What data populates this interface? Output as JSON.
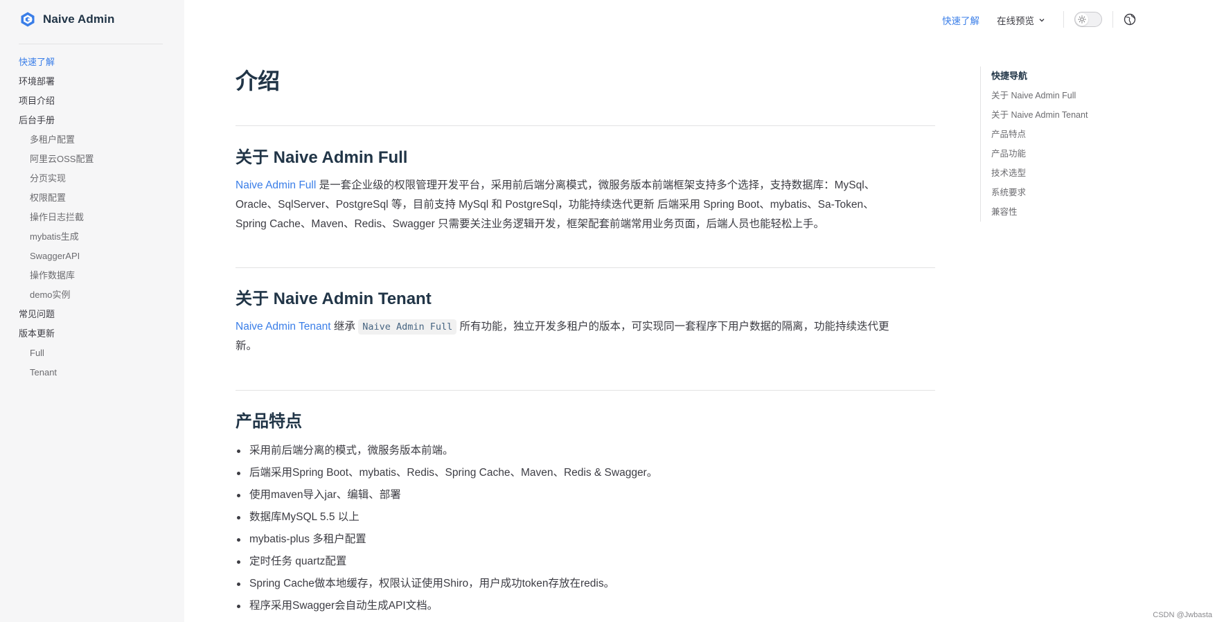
{
  "brand": {
    "name": "Naive Admin",
    "logo_icon": "hexagon-logo-icon"
  },
  "sidebar": {
    "items": [
      {
        "label": "快速了解",
        "level": 0,
        "active": true
      },
      {
        "label": "环境部署",
        "level": 0,
        "active": false
      },
      {
        "label": "项目介绍",
        "level": 0,
        "active": false
      },
      {
        "label": "后台手册",
        "level": 0,
        "active": false
      },
      {
        "label": "多租户配置",
        "level": 1,
        "active": false
      },
      {
        "label": "阿里云OSS配置",
        "level": 1,
        "active": false
      },
      {
        "label": "分页实现",
        "level": 1,
        "active": false
      },
      {
        "label": "权限配置",
        "level": 1,
        "active": false
      },
      {
        "label": "操作日志拦截",
        "level": 1,
        "active": false
      },
      {
        "label": "mybatis生成",
        "level": 1,
        "active": false
      },
      {
        "label": "SwaggerAPI",
        "level": 1,
        "active": false
      },
      {
        "label": "操作数据库",
        "level": 1,
        "active": false
      },
      {
        "label": "demo实例",
        "level": 1,
        "active": false
      },
      {
        "label": "常见问题",
        "level": 0,
        "active": false
      },
      {
        "label": "版本更新",
        "level": 0,
        "active": false
      },
      {
        "label": "Full",
        "level": 1,
        "active": false
      },
      {
        "label": "Tenant",
        "level": 1,
        "active": false
      }
    ]
  },
  "topnav": {
    "quick_label": "快速了解",
    "preview_label": "在线预览",
    "theme_toggle_icon": "sun-icon",
    "language_icon": "globe-icon"
  },
  "main": {
    "title": "介绍",
    "sections": {
      "full": {
        "heading": "关于 Naive Admin Full",
        "link_text": "Naive Admin Full",
        "text_1": " 是一套企业级的权限管理开发平台，采用前后端分离模式，微服务版本前端框架支持多个选择，支持数据库：MySql、",
        "text_2": "Oracle、SqlServer、PostgreSql 等，目前支持 MySql 和 PostgreSql，功能持续迭代更新 后端采用 Spring Boot、mybatis、Sa-Token、",
        "text_3": "Spring Cache、Maven、Redis、Swagger 只需要关注业务逻辑开发，框架配套前端常用业务页面，后端人员也能轻松上手。"
      },
      "tenant": {
        "heading": "关于 Naive Admin Tenant",
        "link_text": "Naive Admin Tenant",
        "text_before": " 继承 ",
        "code": "Naive Admin Full",
        "text_1": " 所有功能，独立开发多租户的版本，可实现同一套程序下用户数据的隔离，功能持续迭代更",
        "text_2": "新。"
      },
      "features": {
        "heading": "产品特点",
        "items": [
          "采用前后端分离的模式，微服务版本前端。",
          "后端采用Spring Boot、mybatis、Redis、Spring Cache、Maven、Redis & Swagger。",
          "使用maven导入jar、编辑、部署",
          "数据库MySQL 5.5 以上",
          "mybatis-plus 多租户配置",
          "定时任务 quartz配置",
          "Spring Cache做本地缓存，权限认证使用Shiro，用户成功token存放在redis。",
          "程序采用Swagger会自动生成API文档。"
        ]
      }
    }
  },
  "outline": {
    "title": "快捷导航",
    "items": [
      "关于 Naive Admin Full",
      "关于 Naive Admin Tenant",
      "产品特点",
      "产品功能",
      "技术选型",
      "系统要求",
      "兼容性"
    ]
  },
  "watermark": "CSDN @Jwbasta",
  "colors": {
    "accent": "#3a7ee8",
    "text": "#213547",
    "muted": "#6b6b6f",
    "sidebar_bg": "#f6f6f7"
  }
}
